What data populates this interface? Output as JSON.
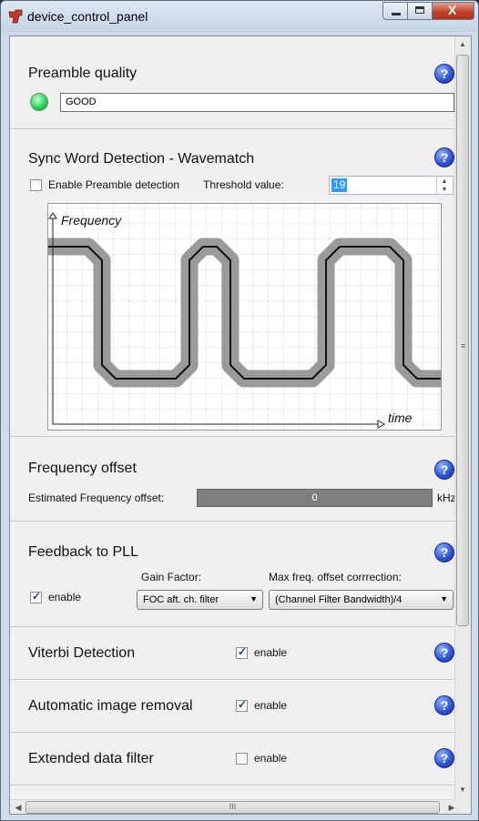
{
  "window": {
    "title": "device_control_panel",
    "app_icon": "ti-logo-icon",
    "buttons": {
      "minimize": "minimize-icon",
      "maximize": "maximize-icon",
      "close": "X"
    }
  },
  "help_glyph": "?",
  "preamble_quality": {
    "title": "Preamble quality",
    "status_led_color": "#2bd45b",
    "status_value": "GOOD"
  },
  "sync_word": {
    "title": "Sync Word Detection - Wavematch",
    "enable_label": "Enable Preamble detection",
    "enable_checked": false,
    "threshold_label": "Threshold value:",
    "threshold_value": "19",
    "plot": {
      "y_label": "Frequency",
      "x_label": "time"
    }
  },
  "frequency_offset": {
    "title": "Frequency offset",
    "estimated_label": "Estimated Frequency offset:",
    "value": "0",
    "unit": "kHz"
  },
  "feedback_pll": {
    "title": "Feedback to PLL",
    "enable_label": "enable",
    "enable_checked": true,
    "gain_label": "Gain Factor:",
    "gain_value": "FOC aft. ch. filter",
    "max_label": "Max freq. offset corrrection:",
    "max_value": "(Channel Filter Bandwidth)/4"
  },
  "viterbi": {
    "title": "Viterbi Detection",
    "enable_label": "enable",
    "enable_checked": true
  },
  "image_removal": {
    "title": "Automatic image removal",
    "enable_label": "enable",
    "enable_checked": true
  },
  "extended_filter": {
    "title": "Extended data filter",
    "enable_label": "enable",
    "enable_checked": false
  },
  "scrollbars": {
    "h_grip": "III",
    "v_grip": "≡"
  }
}
